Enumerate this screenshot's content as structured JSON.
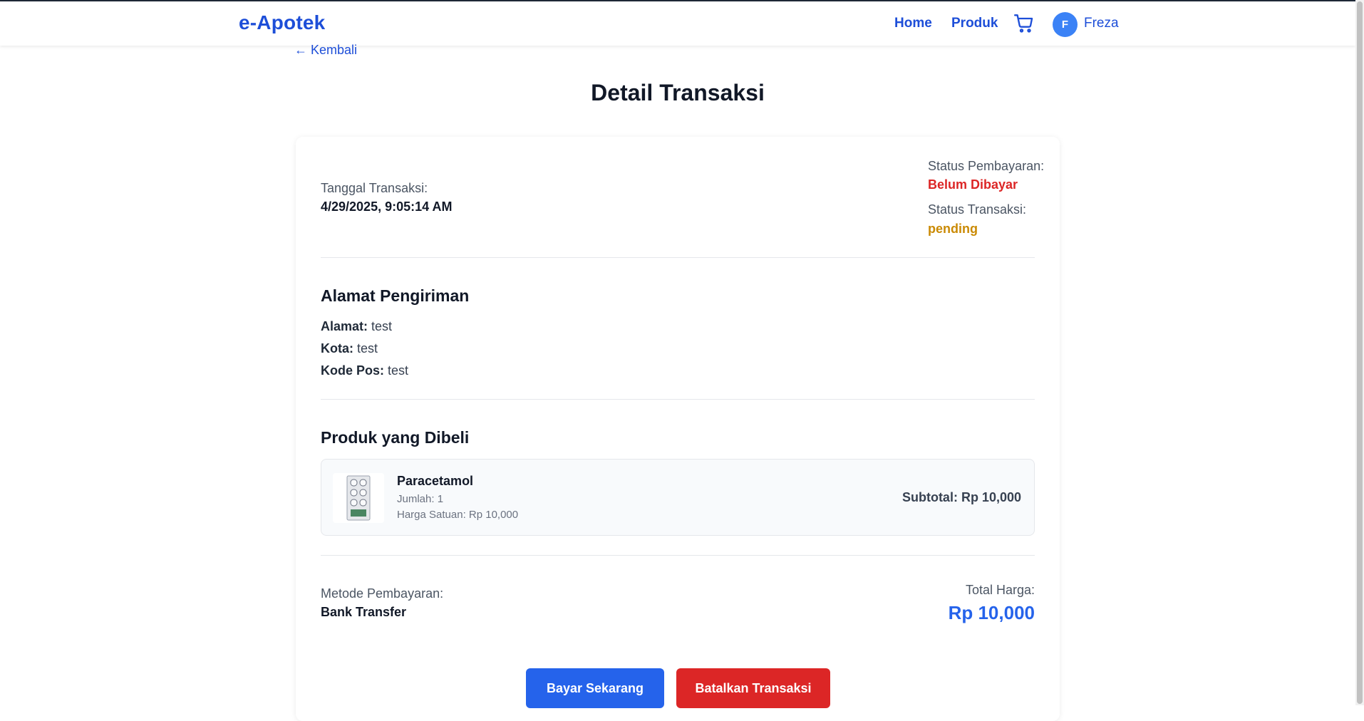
{
  "header": {
    "brand": "e-Apotek",
    "nav": {
      "home": "Home",
      "produk": "Produk"
    },
    "cart_icon": "cart-icon",
    "user": {
      "initial": "F",
      "name": "Freza"
    }
  },
  "page": {
    "back_label": "← Kembali",
    "title": "Detail Transaksi"
  },
  "transaction": {
    "date_label": "Tanggal Transaksi:",
    "date_value": "4/29/2025, 9:05:14 AM",
    "payment_status_label": "Status Pembayaran:",
    "payment_status_value": "Belum Dibayar",
    "transaction_status_label": "Status Transaksi:",
    "transaction_status_value": "pending"
  },
  "shipping": {
    "title": "Alamat Pengiriman",
    "address_label": "Alamat:",
    "address_value": "test",
    "city_label": "Kota:",
    "city_value": "test",
    "postal_label": "Kode Pos:",
    "postal_value": "test"
  },
  "products": {
    "title": "Produk yang Dibeli",
    "items": [
      {
        "name": "Paracetamol",
        "qty_text": "Jumlah: 1",
        "unit_price_text": "Harga Satuan: Rp 10,000",
        "subtotal_text": "Subtotal: Rp 10,000"
      }
    ]
  },
  "payment": {
    "method_label": "Metode Pembayaran:",
    "method_value": "Bank Transfer",
    "total_label": "Total Harga:",
    "total_value": "Rp 10,000"
  },
  "actions": {
    "pay_label": "Bayar Sekarang",
    "cancel_label": "Batalkan Transaksi"
  },
  "colors": {
    "brand": "#1d4ed8",
    "accent": "#2563eb",
    "danger": "#dc2626",
    "pending": "#ca8a04"
  }
}
